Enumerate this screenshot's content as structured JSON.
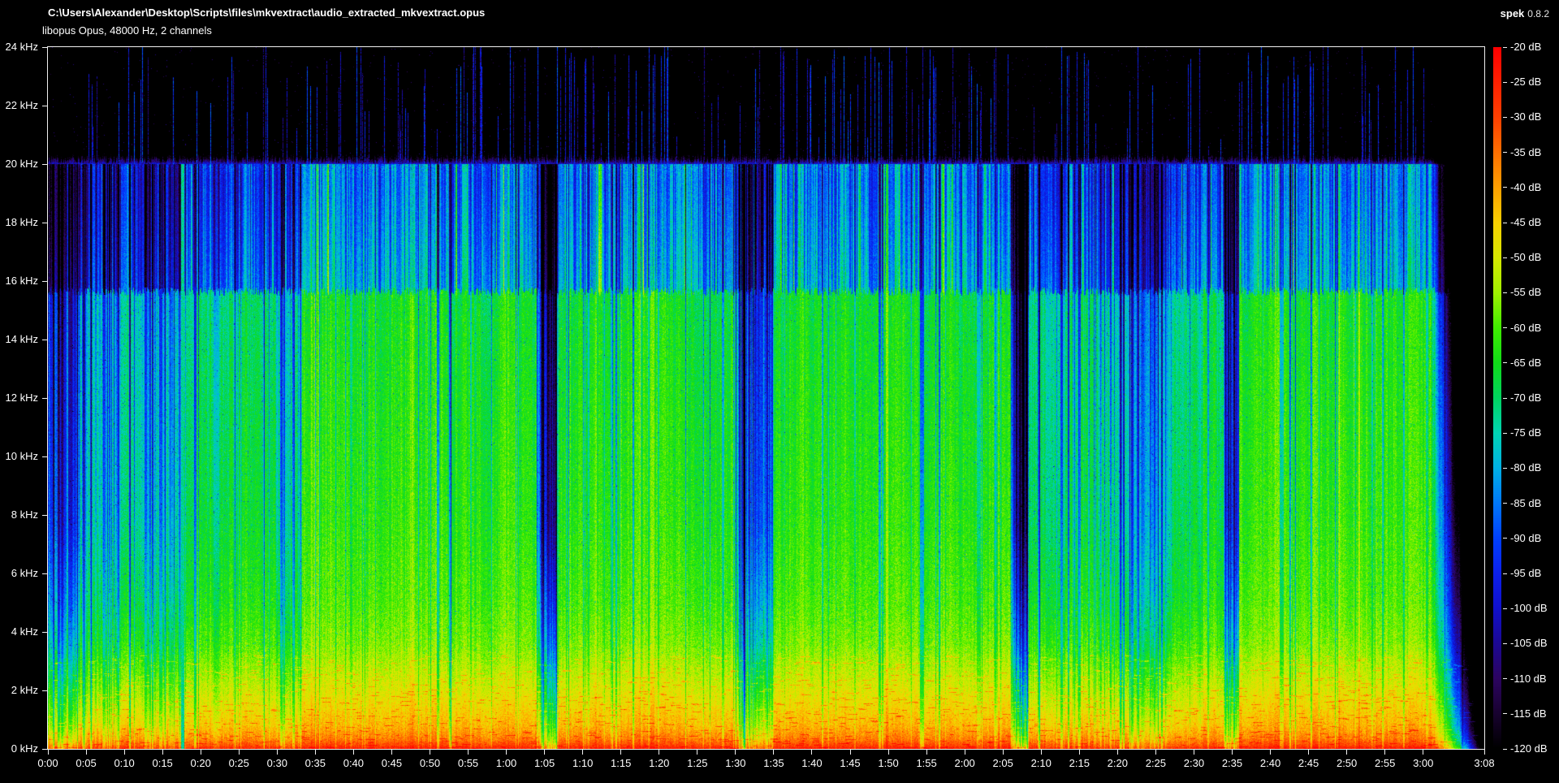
{
  "header": {
    "file_path": "C:\\Users\\Alexander\\Desktop\\Scripts\\files\\mkvextract\\audio_extracted_mkvextract.opus",
    "codec_info": "libopus Opus, 48000 Hz, 2 channels",
    "app_name": "spek",
    "app_version": "0.8.2"
  },
  "axes": {
    "freq_ticks": [
      {
        "khz": 24,
        "label": "24 kHz"
      },
      {
        "khz": 22,
        "label": "22 kHz"
      },
      {
        "khz": 20,
        "label": "20 kHz"
      },
      {
        "khz": 18,
        "label": "18 kHz"
      },
      {
        "khz": 16,
        "label": "16 kHz"
      },
      {
        "khz": 14,
        "label": "14 kHz"
      },
      {
        "khz": 12,
        "label": "12 kHz"
      },
      {
        "khz": 10,
        "label": "10 kHz"
      },
      {
        "khz": 8,
        "label": "8 kHz"
      },
      {
        "khz": 6,
        "label": "6 kHz"
      },
      {
        "khz": 4,
        "label": "4 kHz"
      },
      {
        "khz": 2,
        "label": "2 kHz"
      },
      {
        "khz": 0,
        "label": "0 kHz"
      }
    ],
    "time_ticks": [
      {
        "s": 0,
        "label": "0:00"
      },
      {
        "s": 5,
        "label": "0:05"
      },
      {
        "s": 10,
        "label": "0:10"
      },
      {
        "s": 15,
        "label": "0:15"
      },
      {
        "s": 20,
        "label": "0:20"
      },
      {
        "s": 25,
        "label": "0:25"
      },
      {
        "s": 30,
        "label": "0:30"
      },
      {
        "s": 35,
        "label": "0:35"
      },
      {
        "s": 40,
        "label": "0:40"
      },
      {
        "s": 45,
        "label": "0:45"
      },
      {
        "s": 50,
        "label": "0:50"
      },
      {
        "s": 55,
        "label": "0:55"
      },
      {
        "s": 60,
        "label": "1:00"
      },
      {
        "s": 65,
        "label": "1:05"
      },
      {
        "s": 70,
        "label": "1:10"
      },
      {
        "s": 75,
        "label": "1:15"
      },
      {
        "s": 80,
        "label": "1:20"
      },
      {
        "s": 85,
        "label": "1:25"
      },
      {
        "s": 90,
        "label": "1:30"
      },
      {
        "s": 95,
        "label": "1:35"
      },
      {
        "s": 100,
        "label": "1:40"
      },
      {
        "s": 105,
        "label": "1:45"
      },
      {
        "s": 110,
        "label": "1:50"
      },
      {
        "s": 115,
        "label": "1:55"
      },
      {
        "s": 120,
        "label": "2:00"
      },
      {
        "s": 125,
        "label": "2:05"
      },
      {
        "s": 130,
        "label": "2:10"
      },
      {
        "s": 135,
        "label": "2:15"
      },
      {
        "s": 140,
        "label": "2:20"
      },
      {
        "s": 145,
        "label": "2:25"
      },
      {
        "s": 150,
        "label": "2:30"
      },
      {
        "s": 155,
        "label": "2:35"
      },
      {
        "s": 160,
        "label": "2:40"
      },
      {
        "s": 165,
        "label": "2:45"
      },
      {
        "s": 170,
        "label": "2:50"
      },
      {
        "s": 175,
        "label": "2:55"
      },
      {
        "s": 180,
        "label": "3:00"
      },
      {
        "s": 188,
        "label": "3:08"
      }
    ],
    "db_ticks": [
      {
        "db": -20,
        "label": "-20 dB"
      },
      {
        "db": -25,
        "label": "-25 dB"
      },
      {
        "db": -30,
        "label": "-30 dB"
      },
      {
        "db": -35,
        "label": "-35 dB"
      },
      {
        "db": -40,
        "label": "-40 dB"
      },
      {
        "db": -45,
        "label": "-45 dB"
      },
      {
        "db": -50,
        "label": "-50 dB"
      },
      {
        "db": -55,
        "label": "-55 dB"
      },
      {
        "db": -60,
        "label": "-60 dB"
      },
      {
        "db": -65,
        "label": "-65 dB"
      },
      {
        "db": -70,
        "label": "-70 dB"
      },
      {
        "db": -75,
        "label": "-75 dB"
      },
      {
        "db": -80,
        "label": "-80 dB"
      },
      {
        "db": -85,
        "label": "-85 dB"
      },
      {
        "db": -90,
        "label": "-90 dB"
      },
      {
        "db": -95,
        "label": "-95 dB"
      },
      {
        "db": -100,
        "label": "-100 dB"
      },
      {
        "db": -105,
        "label": "-105 dB"
      },
      {
        "db": -110,
        "label": "-110 dB"
      },
      {
        "db": -115,
        "label": "-115 dB"
      },
      {
        "db": -120,
        "label": "-120 dB"
      }
    ]
  },
  "spectrogram": {
    "type": "spectrogram",
    "duration_s": 188,
    "freq_range_khz": [
      0,
      24
    ],
    "db_range": [
      -120,
      -20
    ],
    "lowpass_khz": 20,
    "content_ceiling_khz": 15.65,
    "palette_stops_rgb": [
      [
        255,
        0,
        0
      ],
      [
        255,
        32,
        0
      ],
      [
        255,
        64,
        0
      ],
      [
        255,
        112,
        0
      ],
      [
        255,
        160,
        0
      ],
      [
        248,
        208,
        0
      ],
      [
        216,
        232,
        0
      ],
      [
        160,
        240,
        0
      ],
      [
        64,
        236,
        0
      ],
      [
        16,
        220,
        24
      ],
      [
        0,
        212,
        96
      ],
      [
        0,
        212,
        180
      ],
      [
        0,
        176,
        228
      ],
      [
        0,
        120,
        248
      ],
      [
        0,
        64,
        252
      ],
      [
        12,
        32,
        236
      ],
      [
        16,
        16,
        204
      ],
      [
        28,
        8,
        148
      ],
      [
        44,
        4,
        96
      ],
      [
        24,
        2,
        48
      ],
      [
        0,
        0,
        0
      ]
    ],
    "base_spectrum_db": [
      [
        0,
        -23
      ],
      [
        0.12,
        -29
      ],
      [
        0.35,
        -36
      ],
      [
        0.8,
        -42
      ],
      [
        1.6,
        -47
      ],
      [
        2.6,
        -52
      ],
      [
        3.6,
        -56.5
      ],
      [
        5,
        -59.5
      ],
      [
        8,
        -62
      ],
      [
        12,
        -63.5
      ],
      [
        15.65,
        -65.5
      ]
    ],
    "hi_band_db": {
      "at_ceiling": -79,
      "at_20khz": -87
    },
    "segments": [
      {
        "t0": 0,
        "t1": 4.2,
        "level": -26,
        "stripe": 9,
        "darkStripeProb": 0.45,
        "spikeProb": 0.02,
        "hiStripe": 8
      },
      {
        "t0": 4.2,
        "t1": 17.4,
        "level": -13,
        "stripe": 8,
        "darkStripeProb": 0.25,
        "spikeProb": 0.05,
        "hiStripe": 9
      },
      {
        "t0": 17.4,
        "t1": 17.85,
        "level": 0,
        "stripe": 0,
        "darkStripeProb": 0,
        "spikeProb": 0,
        "hiStripe": 0,
        "accent": true
      },
      {
        "t0": 17.85,
        "t1": 29.8,
        "level": -3,
        "stripe": 5,
        "darkStripeProb": 0.08,
        "spikeProb": 0.1,
        "hiStripe": 10
      },
      {
        "t0": 29.8,
        "t1": 33.2,
        "level": -11,
        "stripe": 7,
        "darkStripeProb": 0.3,
        "spikeProb": 0.06,
        "hiStripe": 9
      },
      {
        "t0": 33.2,
        "t1": 63.6,
        "level": 0,
        "stripe": 4.5,
        "darkStripeProb": 0.06,
        "spikeProb": 0.13,
        "hiStripe": 10
      },
      {
        "t0": 63.6,
        "t1": 66.6,
        "level": -34,
        "stripe": 9,
        "darkStripeProb": 0.5,
        "spikeProb": 0.02,
        "hiStripe": 6,
        "gap": true
      },
      {
        "t0": 66.6,
        "t1": 89.6,
        "level": -0.5,
        "stripe": 4.5,
        "darkStripeProb": 0.07,
        "spikeProb": 0.12,
        "hiStripe": 10
      },
      {
        "t0": 89.6,
        "t1": 94.8,
        "level": -21,
        "stripe": 9,
        "darkStripeProb": 0.35,
        "spikeProb": 0.04,
        "hiStripe": 8,
        "gap": true
      },
      {
        "t0": 94.8,
        "t1": 125.8,
        "level": 0,
        "stripe": 4.5,
        "darkStripeProb": 0.06,
        "spikeProb": 0.13,
        "hiStripe": 10
      },
      {
        "t0": 125.8,
        "t1": 128.2,
        "level": -36,
        "stripe": 8,
        "darkStripeProb": 0.55,
        "spikeProb": 0.02,
        "hiStripe": 6,
        "gap": true
      },
      {
        "t0": 128.2,
        "t1": 140,
        "level": -8,
        "stripe": 6,
        "darkStripeProb": 0.15,
        "spikeProb": 0.08,
        "hiStripe": 10
      },
      {
        "t0": 140,
        "t1": 147,
        "level": -14,
        "stripe": 7,
        "darkStripeProb": 0.3,
        "spikeProb": 0.06,
        "hiStripe": 9
      },
      {
        "t0": 147,
        "t1": 153.6,
        "level": -4,
        "stripe": 5,
        "darkStripeProb": 0.1,
        "spikeProb": 0.1,
        "hiStripe": 10
      },
      {
        "t0": 153.6,
        "t1": 155.9,
        "level": -33,
        "stripe": 8,
        "darkStripeProb": 0.5,
        "spikeProb": 0.02,
        "hiStripe": 6,
        "gap": true
      },
      {
        "t0": 155.9,
        "t1": 181,
        "level": 0,
        "stripe": 4.5,
        "darkStripeProb": 0.06,
        "spikeProb": 0.12,
        "hiStripe": 10
      },
      {
        "t0": 181,
        "t1": 188.1,
        "level": -2,
        "stripe": 5,
        "darkStripeProb": 0.1,
        "spikeProb": 0,
        "hiStripe": 6,
        "fade": true
      }
    ]
  }
}
